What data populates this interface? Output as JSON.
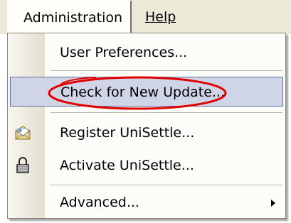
{
  "menubar": {
    "administration_label": "Administration",
    "help_label": "Help"
  },
  "menu": {
    "items": [
      {
        "label": "User Preferences...",
        "icon": null
      },
      {
        "label": "Check for New Update...",
        "icon": null,
        "highlighted": true,
        "annotated": true
      },
      {
        "label": "Register UniSettle...",
        "icon": "envelope-icon"
      },
      {
        "label": "Activate UniSettle...",
        "icon": "padlock-icon"
      },
      {
        "label": "Advanced...",
        "icon": null,
        "submenu": true
      }
    ]
  },
  "colors": {
    "menu_highlight": "#cfd5e6",
    "annotation": "#e00000"
  }
}
